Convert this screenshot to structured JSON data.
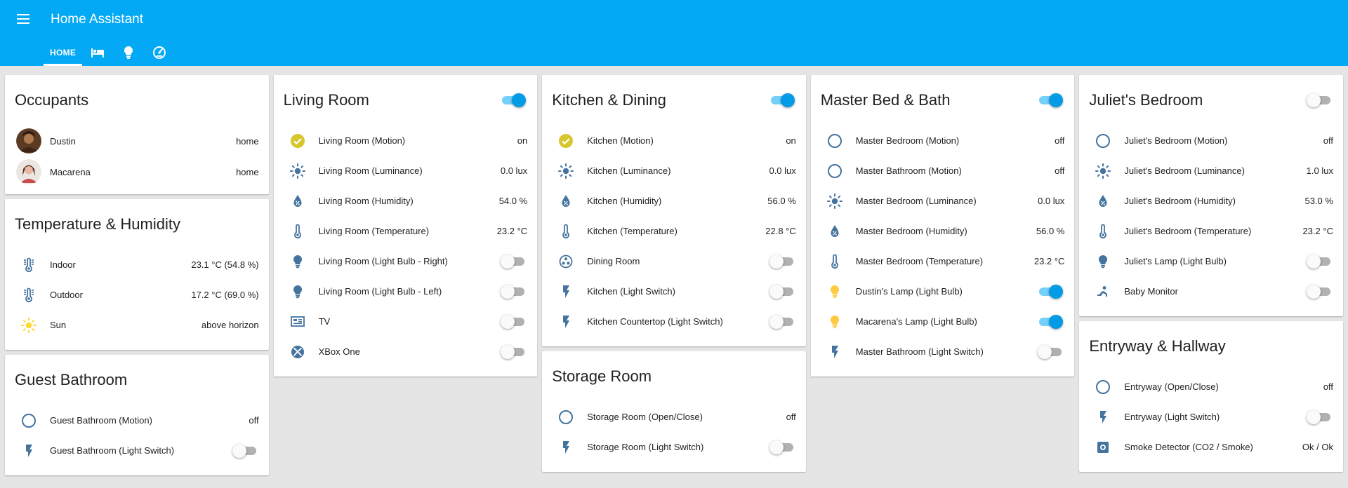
{
  "app": {
    "title": "Home Assistant"
  },
  "tabs": [
    {
      "label": "HOME",
      "active": true
    },
    {
      "icon": "bed-icon"
    },
    {
      "icon": "lightbulb-icon"
    },
    {
      "icon": "gauge-icon"
    }
  ],
  "colors": {
    "header": "#03a9f4",
    "icon": "#44739e",
    "active_yellow": "#fdd835",
    "lamp_on": "#ffc940",
    "toggle_on": "#039be5"
  },
  "occupants": {
    "title": "Occupants",
    "rows": [
      {
        "name": "Dustin",
        "state": "home"
      },
      {
        "name": "Macarena",
        "state": "home"
      }
    ]
  },
  "temp_humidity": {
    "title": "Temperature & Humidity",
    "rows": [
      {
        "name": "Indoor",
        "state": "23.1 °C (54.8 %)",
        "icon": "thermometer-lines-icon"
      },
      {
        "name": "Outdoor",
        "state": "17.2 °C (69.0 %)",
        "icon": "thermometer-lines-icon"
      },
      {
        "name": "Sun",
        "state": "above horizon",
        "icon": "sun-icon"
      }
    ]
  },
  "guest_bathroom": {
    "title": "Guest Bathroom",
    "rows": [
      {
        "name": "Guest Bathroom (Motion)",
        "state": "off",
        "icon": "circle-outline-icon"
      },
      {
        "name": "Guest Bathroom (Light Switch)",
        "toggle": false,
        "icon": "flash-icon"
      }
    ]
  },
  "living_room": {
    "title": "Living Room",
    "toggle": true,
    "rows": [
      {
        "name": "Living Room (Motion)",
        "state": "on",
        "icon": "check-circle-icon"
      },
      {
        "name": "Living Room (Luminance)",
        "state": "0.0 lux",
        "icon": "brightness-icon"
      },
      {
        "name": "Living Room (Humidity)",
        "state": "54.0 %",
        "icon": "water-percent-icon"
      },
      {
        "name": "Living Room (Temperature)",
        "state": "23.2 °C",
        "icon": "thermometer-icon"
      },
      {
        "name": "Living Room (Light Bulb - Right)",
        "toggle": false,
        "icon": "lightbulb-icon"
      },
      {
        "name": "Living Room (Light Bulb - Left)",
        "toggle": false,
        "icon": "lightbulb-icon"
      },
      {
        "name": "TV",
        "toggle": false,
        "icon": "tv-guide-icon"
      },
      {
        "name": "XBox One",
        "toggle": false,
        "icon": "xbox-icon"
      }
    ]
  },
  "kitchen": {
    "title": "Kitchen & Dining",
    "toggle": true,
    "rows": [
      {
        "name": "Kitchen (Motion)",
        "state": "on",
        "icon": "check-circle-icon"
      },
      {
        "name": "Kitchen (Luminance)",
        "state": "0.0 lux",
        "icon": "brightness-icon"
      },
      {
        "name": "Kitchen (Humidity)",
        "state": "56.0 %",
        "icon": "water-percent-icon"
      },
      {
        "name": "Kitchen (Temperature)",
        "state": "22.8 °C",
        "icon": "thermometer-icon"
      },
      {
        "name": "Dining Room",
        "toggle": false,
        "icon": "fan-icon"
      },
      {
        "name": "Kitchen (Light Switch)",
        "toggle": false,
        "icon": "flash-icon"
      },
      {
        "name": "Kitchen Countertop (Light Switch)",
        "toggle": false,
        "icon": "flash-icon"
      }
    ]
  },
  "storage_room": {
    "title": "Storage Room",
    "rows": [
      {
        "name": "Storage Room (Open/Close)",
        "state": "off",
        "icon": "circle-outline-icon"
      },
      {
        "name": "Storage Room (Light Switch)",
        "toggle": false,
        "icon": "flash-icon"
      }
    ]
  },
  "master": {
    "title": "Master Bed & Bath",
    "toggle": true,
    "rows": [
      {
        "name": "Master Bedroom (Motion)",
        "state": "off",
        "icon": "circle-outline-icon"
      },
      {
        "name": "Master Bathroom (Motion)",
        "state": "off",
        "icon": "circle-outline-icon"
      },
      {
        "name": "Master Bedroom (Luminance)",
        "state": "0.0 lux",
        "icon": "brightness-icon"
      },
      {
        "name": "Master Bedroom (Humidity)",
        "state": "56.0 %",
        "icon": "water-percent-icon"
      },
      {
        "name": "Master Bedroom (Temperature)",
        "state": "23.2 °C",
        "icon": "thermometer-icon"
      },
      {
        "name": "Dustin's Lamp (Light Bulb)",
        "toggle": true,
        "icon": "lightbulb-on-icon"
      },
      {
        "name": "Macarena's Lamp (Light Bulb)",
        "toggle": true,
        "icon": "lightbulb-on-icon"
      },
      {
        "name": "Master Bathroom (Light Switch)",
        "toggle": false,
        "icon": "flash-icon"
      }
    ]
  },
  "juliet": {
    "title": "Juliet's Bedroom",
    "toggle": false,
    "rows": [
      {
        "name": "Juliet's Bedroom (Motion)",
        "state": "off",
        "icon": "circle-outline-icon"
      },
      {
        "name": "Juliet's Bedroom (Luminance)",
        "state": "1.0 lux",
        "icon": "brightness-icon"
      },
      {
        "name": "Juliet's Bedroom (Humidity)",
        "state": "53.0 %",
        "icon": "water-percent-icon"
      },
      {
        "name": "Juliet's Bedroom (Temperature)",
        "state": "23.2 °C",
        "icon": "thermometer-icon"
      },
      {
        "name": "Juliet's Lamp (Light Bulb)",
        "toggle": false,
        "icon": "lightbulb-icon"
      },
      {
        "name": "Baby Monitor",
        "toggle": false,
        "icon": "baby-icon"
      }
    ]
  },
  "entryway": {
    "title": "Entryway & Hallway",
    "rows": [
      {
        "name": "Entryway (Open/Close)",
        "state": "off",
        "icon": "circle-outline-icon"
      },
      {
        "name": "Entryway (Light Switch)",
        "toggle": false,
        "icon": "flash-icon"
      },
      {
        "name": "Smoke Detector (CO2 / Smoke)",
        "state": "Ok / Ok",
        "icon": "smoke-detector-icon"
      }
    ]
  }
}
